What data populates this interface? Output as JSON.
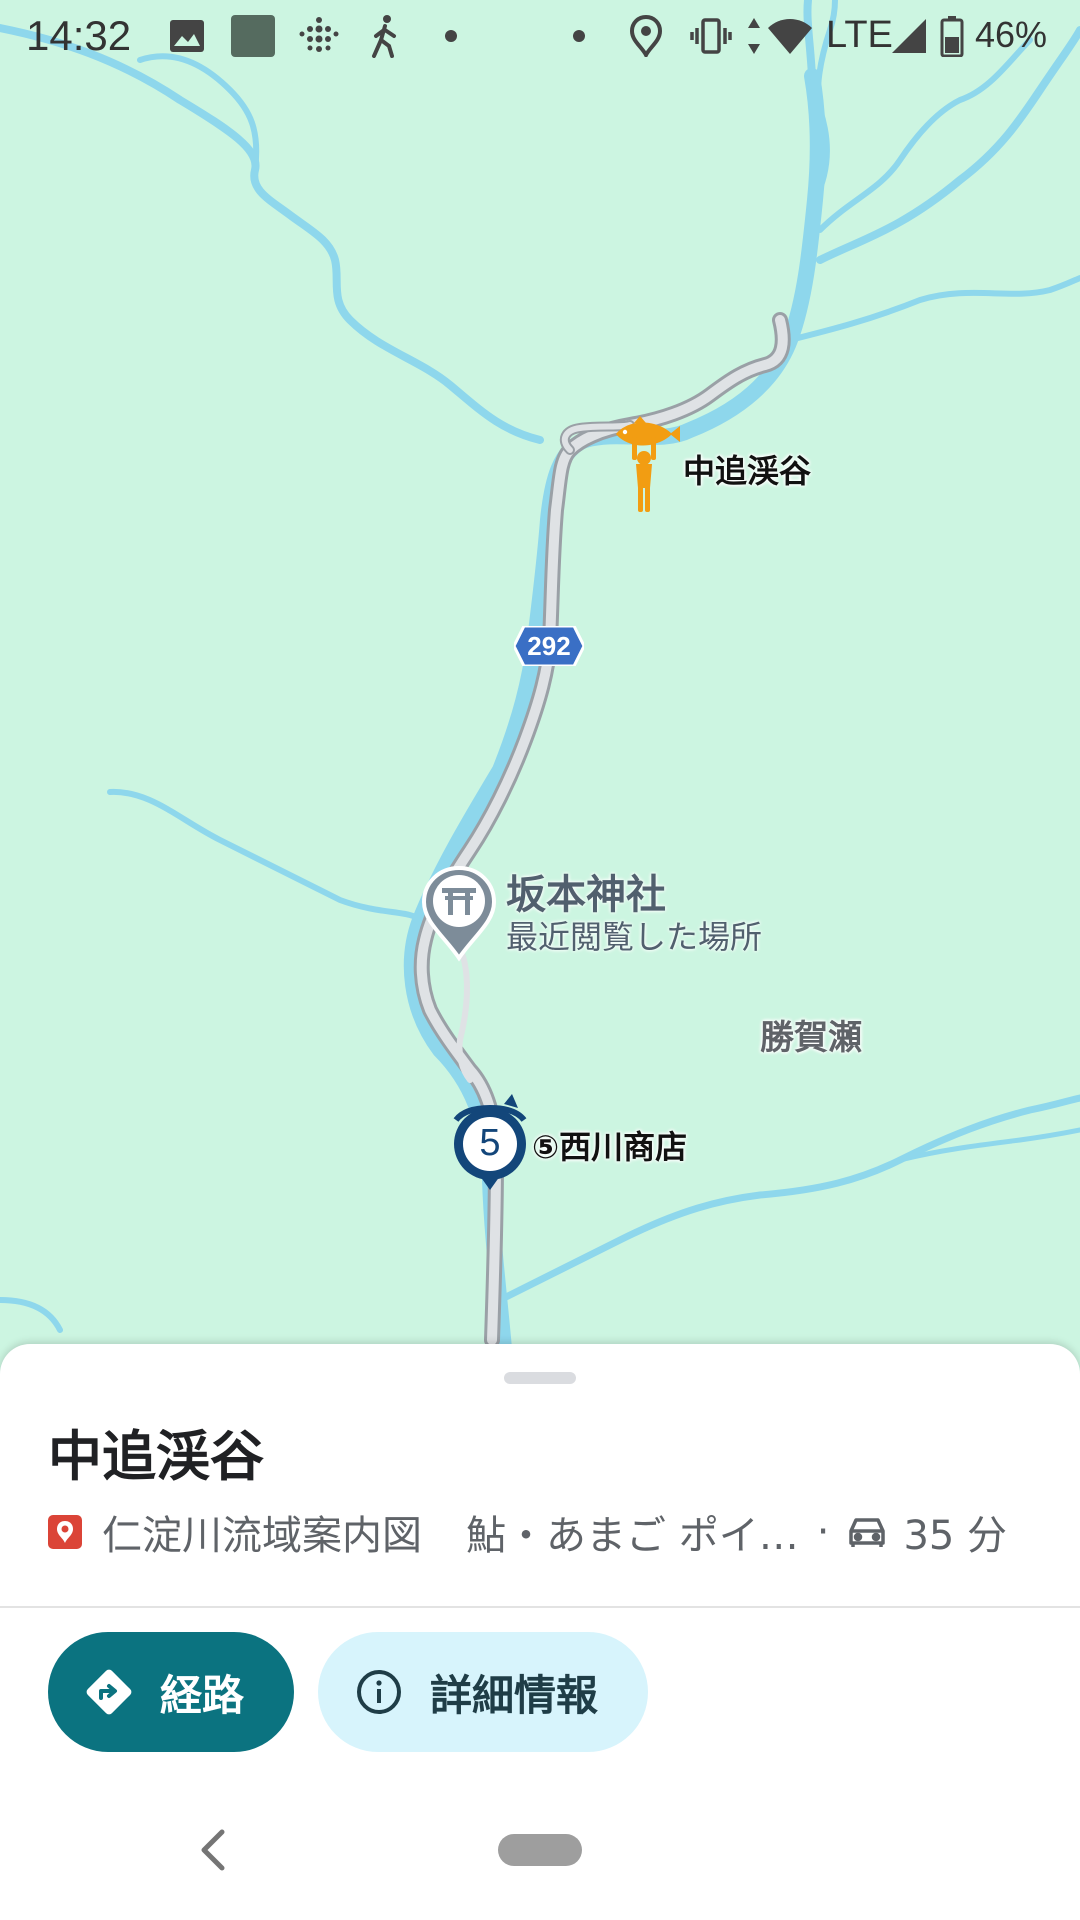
{
  "status_bar": {
    "time": "14:32",
    "icons": [
      "image-icon",
      "app-square-icon",
      "fitbit-icon",
      "walking-icon",
      "dot-icon",
      "dot-icon",
      "location-icon",
      "vibrate-icon",
      "wifi-icon",
      "lte-signal-icon",
      "battery-icon"
    ],
    "network": "LTE",
    "battery_percent": "46%"
  },
  "map": {
    "labels": {
      "destination": "中追渓谷",
      "shrine_name": "坂本神社",
      "shrine_sub": "最近閲覧した場所",
      "area": "勝賀瀬",
      "shop": "⑤西川商店"
    },
    "route_shield": "292",
    "shop_marker_number": "5",
    "colors": {
      "land": "#ccf5e1",
      "river": "#8ed7ec",
      "road": "#b7bcc2",
      "road_shield": "#3a6fc5",
      "fish_marker": "#f29d12",
      "shop_marker": "#13467a"
    }
  },
  "sheet": {
    "title": "中追渓谷",
    "category_icon": "map-pin-icon",
    "category": "仁淀川流域案内図",
    "description": "鮎・あまご ポイ…",
    "separator": "·",
    "drive_icon": "car-icon",
    "drive_time": "35 分",
    "route_button": "経路",
    "info_button": "詳細情報"
  },
  "nav": {
    "back": "back-icon",
    "home": "home-pill"
  }
}
